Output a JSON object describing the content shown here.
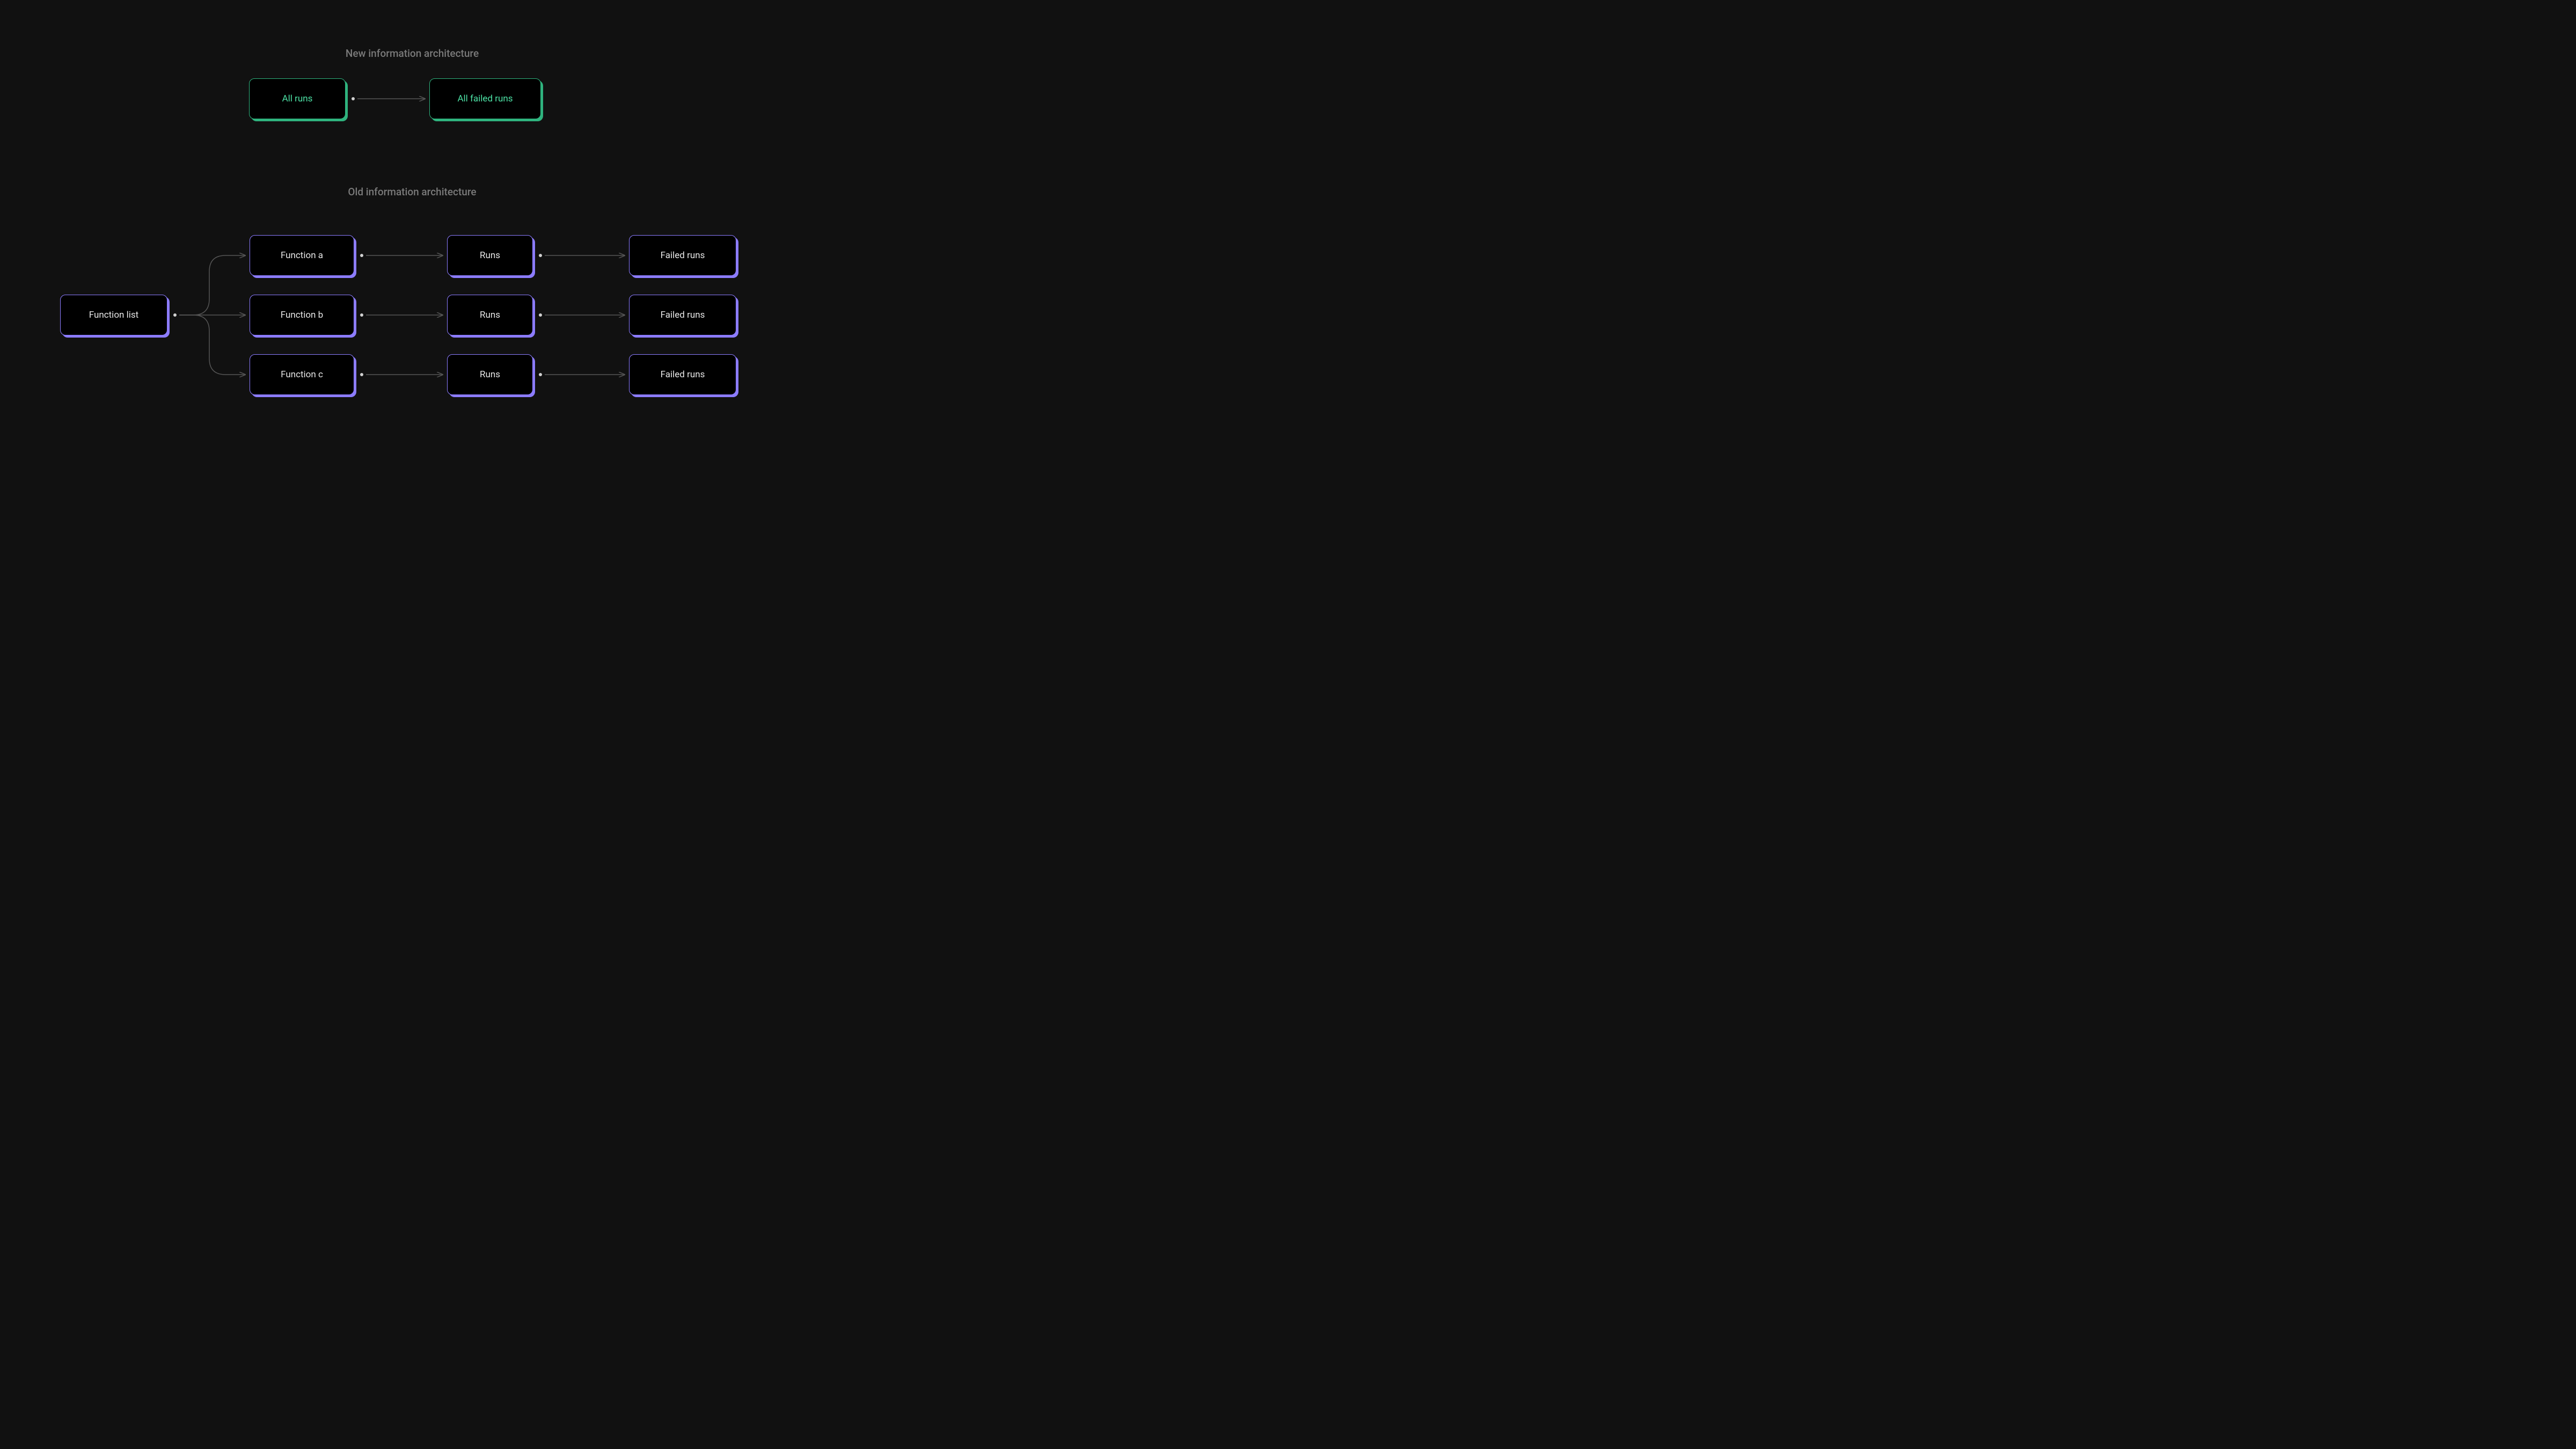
{
  "colors": {
    "background": "#111111",
    "nodeBg": "#000000",
    "green_border": "#2fb37e",
    "green_text": "#4de3a6",
    "purple_border": "#8c7cff",
    "purple_text": "#e8e8e8",
    "title_text": "#7a7a7a",
    "arrow": "#555555"
  },
  "new_arch": {
    "title": "New information architecture",
    "nodes": {
      "all_runs": "All runs",
      "all_failed_runs": "All failed runs"
    }
  },
  "old_arch": {
    "title": "Old information architecture",
    "root": "Function list",
    "rows": [
      {
        "fn": "Function a",
        "runs": "Runs",
        "failed": "Failed runs"
      },
      {
        "fn": "Function b",
        "runs": "Runs",
        "failed": "Failed runs"
      },
      {
        "fn": "Function c",
        "runs": "Runs",
        "failed": "Failed runs"
      }
    ]
  }
}
